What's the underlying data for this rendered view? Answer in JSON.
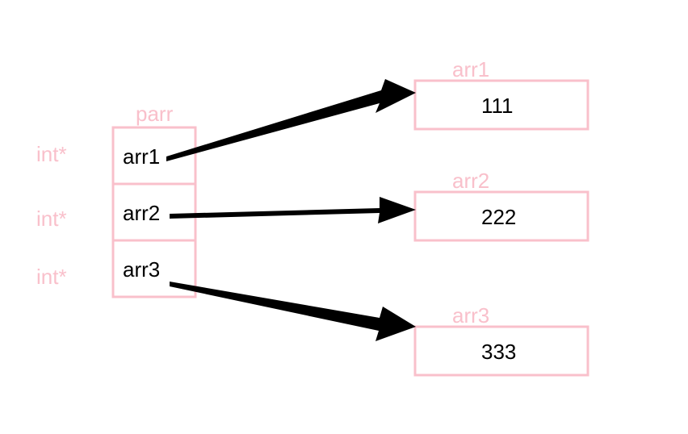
{
  "parr": {
    "label": "parr",
    "type_label": "int*",
    "cells": [
      {
        "name": "arr1"
      },
      {
        "name": "arr2"
      },
      {
        "name": "arr3"
      }
    ]
  },
  "targets": [
    {
      "label": "arr1",
      "value": "111"
    },
    {
      "label": "arr2",
      "value": "222"
    },
    {
      "label": "arr3",
      "value": "333"
    }
  ]
}
